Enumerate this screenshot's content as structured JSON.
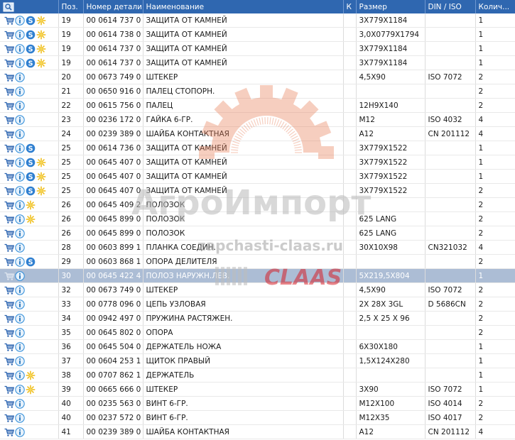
{
  "table": {
    "columns": [
      "",
      "Поз.",
      "Номер детали",
      "Наименование",
      "К",
      "Размер",
      "DIN / ISO",
      "Колич..."
    ],
    "rows": [
      {
        "icons": [
          "cart",
          "info",
          "s",
          "star"
        ],
        "pos": "19",
        "part": "00 0614 737 0",
        "name": "ЗАЩИТА ОТ КАМНЕЙ",
        "k": "",
        "size": "3X779X1184",
        "din": "",
        "qty": "1"
      },
      {
        "icons": [
          "cart",
          "info",
          "s",
          "star"
        ],
        "pos": "19",
        "part": "00 0614 738 0",
        "name": "ЗАЩИТА ОТ КАМНЕЙ",
        "k": "",
        "size": "3,0X0779X1794",
        "din": "",
        "qty": "1"
      },
      {
        "icons": [
          "cart",
          "info",
          "s",
          "star"
        ],
        "pos": "19",
        "part": "00 0614 737 0",
        "name": "ЗАЩИТА ОТ КАМНЕЙ",
        "k": "",
        "size": "3X779X1184",
        "din": "",
        "qty": "1"
      },
      {
        "icons": [
          "cart",
          "info",
          "s",
          "star"
        ],
        "pos": "19",
        "part": "00 0614 737 0",
        "name": "ЗАЩИТА ОТ КАМНЕЙ",
        "k": "",
        "size": "3X779X1184",
        "din": "",
        "qty": "1"
      },
      {
        "icons": [
          "cart",
          "info"
        ],
        "pos": "20",
        "part": "00 0673 749 0",
        "name": "ШТЕКЕР",
        "k": "",
        "size": "4,5X90",
        "din": "ISO 7072",
        "qty": "2"
      },
      {
        "icons": [
          "cart",
          "info"
        ],
        "pos": "21",
        "part": "00 0650 916 0",
        "name": "ПАЛЕЦ СТОПОРН.",
        "k": "",
        "size": "",
        "din": "",
        "qty": "2"
      },
      {
        "icons": [
          "cart",
          "info"
        ],
        "pos": "22",
        "part": "00 0615 756 0",
        "name": "ПАЛЕЦ",
        "k": "",
        "size": "12H9X140",
        "din": "",
        "qty": "2"
      },
      {
        "icons": [
          "cart",
          "info"
        ],
        "pos": "23",
        "part": "00 0236 172 0",
        "name": "ГАЙКА 6-ГР.",
        "k": "",
        "size": "M12",
        "din": "ISO 4032",
        "qty": "4"
      },
      {
        "icons": [
          "cart",
          "info"
        ],
        "pos": "24",
        "part": "00 0239 389 0",
        "name": "ШАЙБА КОНТАКТНАЯ",
        "k": "",
        "size": "A12",
        "din": "CN 201112",
        "qty": "4"
      },
      {
        "icons": [
          "cart",
          "info",
          "s"
        ],
        "pos": "25",
        "part": "00 0614 736 0",
        "name": "ЗАЩИТА ОТ КАМНЕЙ",
        "k": "",
        "size": "3X779X1522",
        "din": "",
        "qty": "1"
      },
      {
        "icons": [
          "cart",
          "info",
          "s",
          "star"
        ],
        "pos": "25",
        "part": "00 0645 407 0",
        "name": "ЗАЩИТА ОТ КАМНЕЙ",
        "k": "",
        "size": "3X779X1522",
        "din": "",
        "qty": "1"
      },
      {
        "icons": [
          "cart",
          "info",
          "s",
          "star"
        ],
        "pos": "25",
        "part": "00 0645 407 0",
        "name": "ЗАЩИТА ОТ КАМНЕЙ",
        "k": "",
        "size": "3X779X1522",
        "din": "",
        "qty": "1"
      },
      {
        "icons": [
          "cart",
          "info",
          "s",
          "star"
        ],
        "pos": "25",
        "part": "00 0645 407 0",
        "name": "ЗАЩИТА ОТ КАМНЕЙ",
        "k": "",
        "size": "3X779X1522",
        "din": "",
        "qty": "2"
      },
      {
        "icons": [
          "cart",
          "info",
          "star"
        ],
        "pos": "26",
        "part": "00 0645 409 2",
        "name": "ПОЛОЗОК",
        "k": "",
        "size": "",
        "din": "",
        "qty": "2"
      },
      {
        "icons": [
          "cart",
          "info",
          "star"
        ],
        "pos": "26",
        "part": "00 0645 899 0",
        "name": "ПОЛОЗОК",
        "k": "",
        "size": "625 LANG",
        "din": "",
        "qty": "2"
      },
      {
        "icons": [
          "cart",
          "info"
        ],
        "pos": "26",
        "part": "00 0645 899 0",
        "name": "ПОЛОЗОК",
        "k": "",
        "size": "625 LANG",
        "din": "",
        "qty": "2"
      },
      {
        "icons": [
          "cart",
          "info"
        ],
        "pos": "28",
        "part": "00 0603 899 1",
        "name": "ПЛАНКА СОЕДИН.",
        "k": "",
        "size": "30X10X98",
        "din": "CN321032",
        "qty": "4"
      },
      {
        "icons": [
          "cart",
          "info",
          "s"
        ],
        "pos": "29",
        "part": "00 0603 868 1",
        "name": "ОПОРА ДЕЛИТЕЛЯ",
        "k": "",
        "size": "",
        "din": "",
        "qty": "2"
      },
      {
        "icons": [
          "cartsel",
          "info"
        ],
        "pos": "30",
        "part": "00 0645 422 4",
        "name": "ПОЛОЗ НАРУЖН.ЛЕВ.",
        "k": "",
        "size": "5X219,5X804",
        "din": "",
        "qty": "1",
        "selected": true
      },
      {
        "icons": [
          "cart",
          "info"
        ],
        "pos": "32",
        "part": "00 0673 749 0",
        "name": "ШТЕКЕР",
        "k": "",
        "size": "4,5X90",
        "din": "ISO 7072",
        "qty": "2"
      },
      {
        "icons": [
          "cart",
          "info"
        ],
        "pos": "33",
        "part": "00 0778 096 0",
        "name": "ЦЕПЬ УЗЛОВАЯ",
        "k": "",
        "size": "2X 28X  3GL",
        "din": "D 5686CN",
        "qty": "2"
      },
      {
        "icons": [
          "cart",
          "info"
        ],
        "pos": "34",
        "part": "00 0942 497 0",
        "name": "ПРУЖИНА РАСТЯЖЕН.",
        "k": "",
        "size": "2,5 X 25  X 96",
        "din": "",
        "qty": "2"
      },
      {
        "icons": [
          "cart",
          "info"
        ],
        "pos": "35",
        "part": "00 0645 802 0",
        "name": "ОПОРА",
        "k": "",
        "size": "",
        "din": "",
        "qty": "2"
      },
      {
        "icons": [
          "cart",
          "info"
        ],
        "pos": "36",
        "part": "00 0645 504 0",
        "name": "ДЕРЖАТЕЛЬ НОЖА",
        "k": "",
        "size": "6X30X180",
        "din": "",
        "qty": "1"
      },
      {
        "icons": [
          "cart",
          "info"
        ],
        "pos": "37",
        "part": "00 0604 253 1",
        "name": "ЩИТОК ПРАВЫЙ",
        "k": "",
        "size": "1,5X124X280",
        "din": "",
        "qty": "1"
      },
      {
        "icons": [
          "cart",
          "info",
          "star"
        ],
        "pos": "38",
        "part": "00 0707 862 1",
        "name": "ДЕРЖАТЕЛЬ",
        "k": "",
        "size": "",
        "din": "",
        "qty": "1"
      },
      {
        "icons": [
          "cart",
          "info",
          "star"
        ],
        "pos": "39",
        "part": "00 0665 666 0",
        "name": "ШТЕКЕР",
        "k": "",
        "size": "3X90",
        "din": "ISO 7072",
        "qty": "1"
      },
      {
        "icons": [
          "cart",
          "info"
        ],
        "pos": "40",
        "part": "00 0235 563 0",
        "name": "ВИНТ 6-ГР.",
        "k": "",
        "size": "M12X100",
        "din": "ISO 4014",
        "qty": "2"
      },
      {
        "icons": [
          "cart",
          "info"
        ],
        "pos": "40",
        "part": "00 0237 572 0",
        "name": "ВИНТ 6-ГР.",
        "k": "",
        "size": "M12X35",
        "din": "ISO 4017",
        "qty": "2"
      },
      {
        "icons": [
          "cart",
          "info"
        ],
        "pos": "41",
        "part": "00 0239 389 0",
        "name": "ШАЙБА КОНТАКТНАЯ",
        "k": "",
        "size": "A12",
        "din": "CN 201112",
        "qty": "4"
      }
    ]
  },
  "watermark": {
    "brand": "АгроИмпорт",
    "site": "zapchasti-claas.ru",
    "logo": "CLAAS"
  },
  "colors": {
    "header_bg": "#2f67b0",
    "selected_row": "#9eb2ce",
    "cart_icon": "#2a63b0",
    "info_icon": "#2a8ad8",
    "star_icon": "#f0c020",
    "watermark_gear": "#e9805a",
    "watermark_logo": "#d6202a"
  }
}
